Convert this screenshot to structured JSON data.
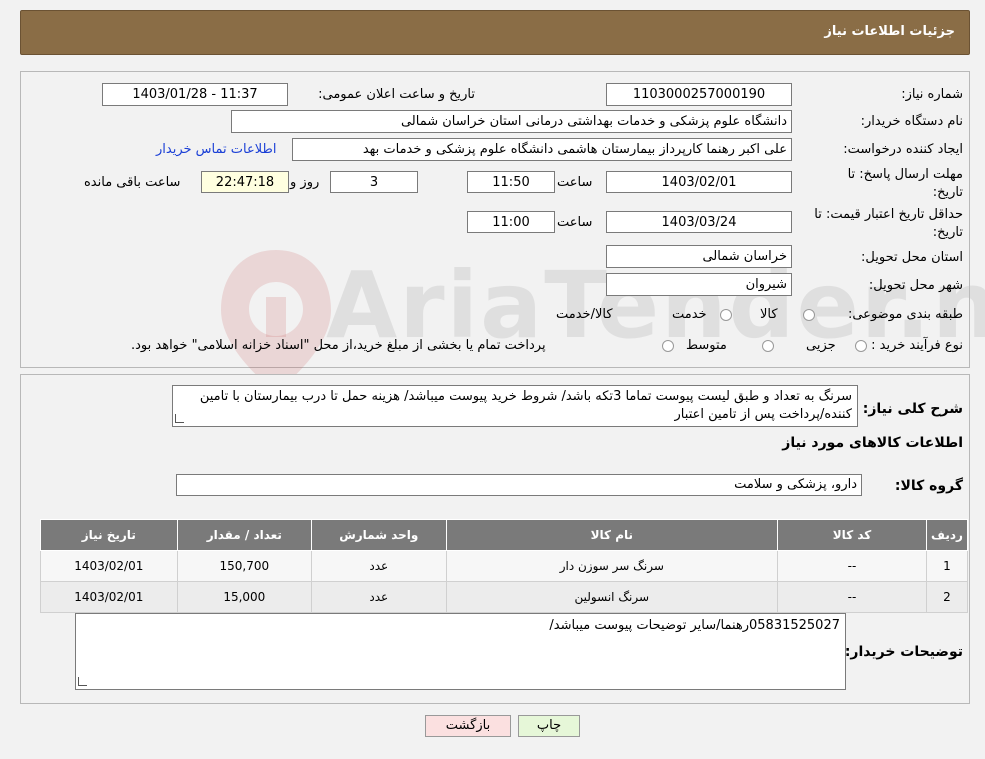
{
  "header": {
    "title": "جزئیات اطلاعات نیاز"
  },
  "watermark": {
    "text": "AriaTender.neT"
  },
  "fields": {
    "need_number_label": "شماره نیاز:",
    "need_number": "1103000257000190",
    "announce_label": "تاریخ و ساعت اعلان عمومی:",
    "announce_value": "1403/01/28 - 11:37",
    "buyer_org_label": "نام دستگاه خریدار:",
    "buyer_org": "دانشگاه علوم پزشکی و خدمات بهداشتی درمانی استان خراسان شمالی",
    "creator_label": "ایجاد کننده درخواست:",
    "creator": "علی اکبر رهنما کارپرداز بیمارستان هاشمی دانشگاه علوم پزشکی و خدمات بهد",
    "contact_link": "اطلاعات تماس خریدار",
    "deadline_label_1": "مهلت ارسال پاسخ: تا",
    "deadline_label_2": "تاریخ:",
    "deadline_date": "1403/02/01",
    "time_label": "ساعت",
    "deadline_time": "11:50",
    "days_value": "3",
    "days_label": "روز و",
    "remaining_time": "22:47:18",
    "remaining_label": "ساعت باقی مانده",
    "validity_label_1": "حداقل تاریخ اعتبار قیمت: تا",
    "validity_label_2": "تاریخ:",
    "validity_date": "1403/03/24",
    "validity_time": "11:00",
    "province_label": "استان محل تحویل:",
    "province": "خراسان شمالی",
    "city_label": "شهر محل تحویل:",
    "city": "شیروان",
    "category_label": "طبقه بندی موضوعی:",
    "category_options": [
      "کالا",
      "خدمت",
      "کالا/خدمت"
    ],
    "process_label": "نوع فرآیند خرید :",
    "process_options": [
      "جزیی",
      "متوسط"
    ],
    "process_note": "پرداخت تمام یا بخشی از مبلغ خرید،از محل \"اسناد خزانه اسلامی\" خواهد بود."
  },
  "description": {
    "label": "شرح کلی نیاز:",
    "text": "سرنگ به تعداد و طبق لیست پیوست تماما 3تکه باشد/ شروط خرید پیوست میباشد/ هزینه حمل تا درب بیمارستان با تامین کننده/پرداخت پس از تامین اعتبار"
  },
  "items_section": {
    "title": "اطلاعات کالاهای مورد نیاز",
    "group_label": "گروه کالا:",
    "group_value": "دارو، پزشکی و سلامت",
    "columns": [
      "ردیف",
      "کد کالا",
      "نام کالا",
      "واحد شمارش",
      "تعداد / مقدار",
      "تاریخ نیاز"
    ],
    "rows": [
      [
        "1",
        "--",
        "سرنگ سر سوزن دار",
        "عدد",
        "150,700",
        "1403/02/01"
      ],
      [
        "2",
        "--",
        "سرنگ انسولین",
        "عدد",
        "15,000",
        "1403/02/01"
      ]
    ]
  },
  "buyer_notes": {
    "label": "توضیحات خریدار:",
    "text": "05831525027رهنما/سایر توضیحات پیوست میباشد/"
  },
  "buttons": {
    "print": "چاپ",
    "back": "بازگشت"
  }
}
